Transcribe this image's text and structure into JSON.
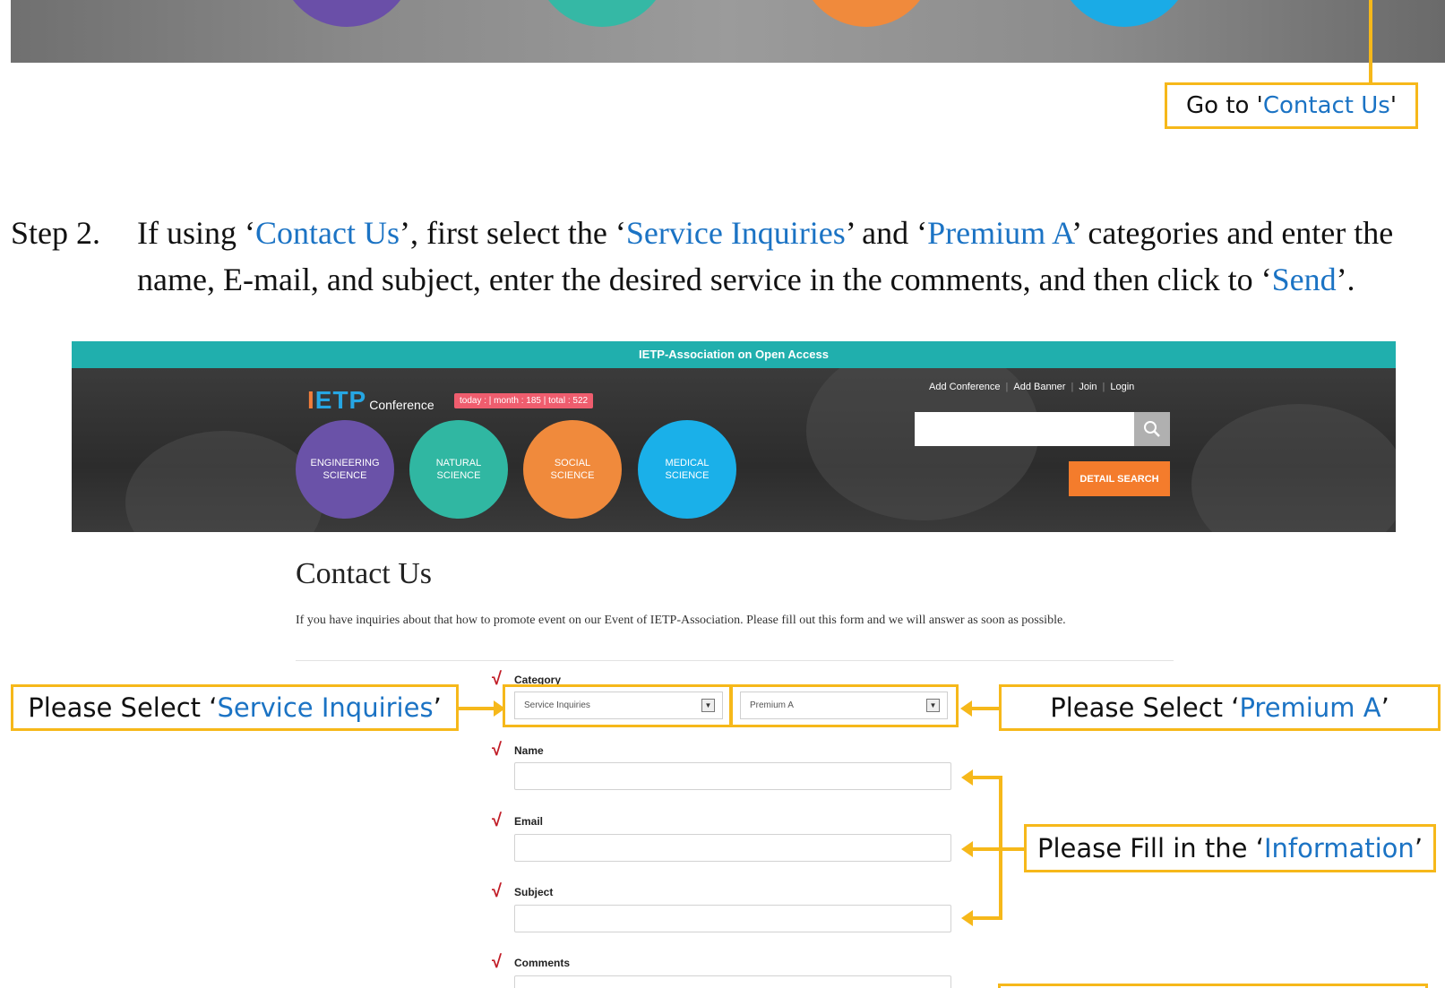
{
  "callouts": {
    "go_to_prefix": "Go to '",
    "go_to_link": "Contact Us",
    "go_to_suffix": "'",
    "service_prefix": "Please Select ‘",
    "service_link": "Service Inquiries",
    "service_suffix": "’",
    "premium_prefix": "Please Select ‘",
    "premium_link": "Premium A",
    "premium_suffix": "’",
    "info_prefix": "Please Fill in the ‘",
    "info_link": "Information",
    "info_suffix": "’"
  },
  "step2": {
    "number": "Step 2.",
    "t1": "If using ‘",
    "contact_us": "Contact Us",
    "t2": "’, first select the ‘",
    "service_inquiries": "Service Inquiries",
    "t3": "’ and ‘",
    "premium_a": "Premium A",
    "t4": "’ categories and enter the name, E-mail, and subject, enter the desired service in the comments, and then click to ‘",
    "send": "Send",
    "t5": "’."
  },
  "site": {
    "topbar_title": "IETP-Association on Open Access",
    "logo_text": "ETP",
    "logo_conference": "Conference",
    "counter": "today :  |  month : 185  |  total : 522",
    "links": {
      "add_conference": "Add Conference",
      "add_banner": "Add Banner",
      "join": "Join",
      "login": "Login"
    },
    "categories": [
      {
        "line1": "ENGINEERING",
        "line2": "SCIENCE"
      },
      {
        "line1": "NATURAL",
        "line2": "SCIENCE"
      },
      {
        "line1": "SOCIAL",
        "line2": "SCIENCE"
      },
      {
        "line1": "MEDICAL",
        "line2": "SCIENCE"
      }
    ],
    "detail_search": "DETAIL SEARCH"
  },
  "contact": {
    "title": "Contact Us",
    "description": "If you have inquiries about that how to promote event on our Event of IETP-Association. Please fill out this form and we will answer as soon as possible.",
    "check_mark": "√",
    "labels": {
      "category": "Category",
      "name": "Name",
      "email": "Email",
      "subject": "Subject",
      "comments": "Comments"
    },
    "category_value": "Service Inquiries",
    "premium_value": "Premium A"
  },
  "colors": {
    "accent_blue": "#1b73c4",
    "callout_yellow": "#f6b81a",
    "topbar_teal": "#20afad",
    "detail_orange": "#f47c2c",
    "check_red": "#c11b25"
  }
}
